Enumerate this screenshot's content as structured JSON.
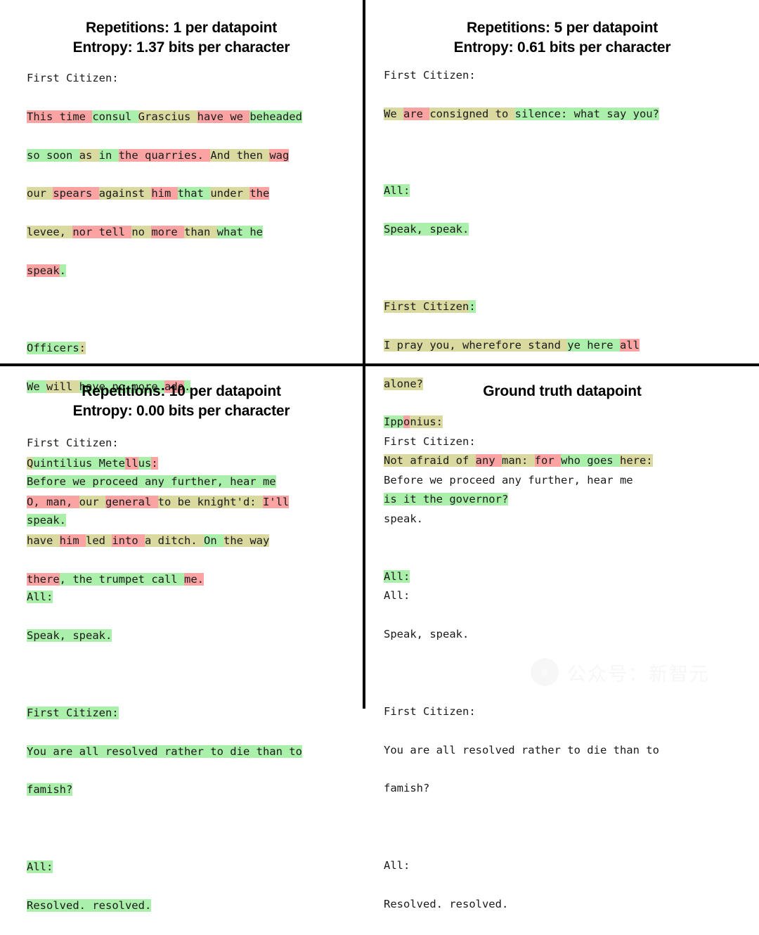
{
  "figure": {
    "background": "#ffffff",
    "divider_color": "#000000",
    "layout": "2x2 grid of text panels"
  },
  "colors": {
    "highlight_low_probability": "#fba3a3",
    "highlight_mid_probability": "#d9d9a0",
    "highlight_high_probability": "#aaf0aa",
    "text": "#1a1a1a",
    "title": "#000000"
  },
  "legend_note": "Token background color encodes model probability: red = low, tan = medium, green = high.",
  "panels": [
    {
      "id": "repetitions-1",
      "title_line1": "Repetitions: 1 per datapoint",
      "title_line2": "Entropy: 1.37 bits per character",
      "repetitions": 1,
      "entropy_bits_per_character": 1.37,
      "highlighted": true,
      "plain_text": "First Citizen:\nThis time consul Grascius have we beheaded\nso soon as in the quarries. And then wag\nour spears against him that under the\nlevee, nor tell no more than what he\nspeak.\n\nOfficers:\nWe will have no more ado.\n\nQuintilius Metellus:\nO, man, our general to be knight'd: I'll\nhave him led into a ditch. On the way\nthere, the trumpet call me.",
      "lines": [
        [
          {
            "t": "First Citizen:",
            "c": "none"
          }
        ],
        [
          {
            "t": "This time ",
            "c": "low"
          },
          {
            "t": "consul ",
            "c": "high"
          },
          {
            "t": "Grascius ",
            "c": "mid"
          },
          {
            "t": "have we ",
            "c": "low"
          },
          {
            "t": "beheaded",
            "c": "high"
          }
        ],
        [
          {
            "t": "so soon ",
            "c": "high"
          },
          {
            "t": "as ",
            "c": "mid"
          },
          {
            "t": "in ",
            "c": "high"
          },
          {
            "t": "the quarries. ",
            "c": "low"
          },
          {
            "t": "And then ",
            "c": "mid"
          },
          {
            "t": "wag",
            "c": "low"
          }
        ],
        [
          {
            "t": "our ",
            "c": "mid"
          },
          {
            "t": "spears ",
            "c": "low"
          },
          {
            "t": "against ",
            "c": "mid"
          },
          {
            "t": "him ",
            "c": "low"
          },
          {
            "t": "that ",
            "c": "high"
          },
          {
            "t": "under ",
            "c": "mid"
          },
          {
            "t": "the",
            "c": "low"
          }
        ],
        [
          {
            "t": "levee, ",
            "c": "mid"
          },
          {
            "t": "nor tell ",
            "c": "low"
          },
          {
            "t": "no ",
            "c": "mid"
          },
          {
            "t": "more ",
            "c": "low"
          },
          {
            "t": "than ",
            "c": "mid"
          },
          {
            "t": "what he",
            "c": "high"
          }
        ],
        [
          {
            "t": "speak",
            "c": "low"
          },
          {
            "t": ".",
            "c": "high"
          }
        ],
        [],
        [
          {
            "t": "Officers",
            "c": "high"
          },
          {
            "t": ":",
            "c": "mid"
          }
        ],
        [
          {
            "t": "We ",
            "c": "high"
          },
          {
            "t": "will ",
            "c": "mid"
          },
          {
            "t": "have no more ",
            "c": "high"
          },
          {
            "t": "ado",
            "c": "low"
          },
          {
            "t": ".",
            "c": "high"
          }
        ],
        [],
        [
          {
            "t": "Q",
            "c": "mid"
          },
          {
            "t": "uintilius Mete",
            "c": "high"
          },
          {
            "t": "ll",
            "c": "low"
          },
          {
            "t": "us",
            "c": "high"
          },
          {
            "t": ":",
            "c": "low"
          }
        ],
        [
          {
            "t": "O, man, ",
            "c": "low"
          },
          {
            "t": "our ",
            "c": "mid"
          },
          {
            "t": "general ",
            "c": "low"
          },
          {
            "t": "to be knight'd: ",
            "c": "mid"
          },
          {
            "t": "I'll",
            "c": "low"
          }
        ],
        [
          {
            "t": "have ",
            "c": "mid"
          },
          {
            "t": "him ",
            "c": "low"
          },
          {
            "t": "led ",
            "c": "mid"
          },
          {
            "t": "into ",
            "c": "low"
          },
          {
            "t": "a ditch. ",
            "c": "mid"
          },
          {
            "t": "On ",
            "c": "high"
          },
          {
            "t": "the way",
            "c": "mid"
          }
        ],
        [
          {
            "t": "there",
            "c": "low"
          },
          {
            "t": ", the trumpet call ",
            "c": "high"
          },
          {
            "t": "me.",
            "c": "low"
          }
        ]
      ]
    },
    {
      "id": "repetitions-5",
      "title_line1": "Repetitions: 5 per datapoint",
      "title_line2": "Entropy: 0.61 bits per character",
      "repetitions": 5,
      "entropy_bits_per_character": 0.61,
      "highlighted": true,
      "plain_text": "First Citizen:\nWe are consigned to silence: what say you?\n\nAll:\nSpeak, speak.\n\nFirst Citizen:\nI pray you, wherefore stand ye here all\nalone?\nIpponius:\nNot afraid of any man: for who goes here:\nis it the governor?\n\nAll:",
      "lines": [
        [
          {
            "t": "First Citizen:",
            "c": "none"
          }
        ],
        [
          {
            "t": "We ",
            "c": "mid"
          },
          {
            "t": "are ",
            "c": "low"
          },
          {
            "t": "consigned to ",
            "c": "mid"
          },
          {
            "t": "silence: what say you?",
            "c": "high"
          }
        ],
        [],
        [
          {
            "t": "All:",
            "c": "high"
          }
        ],
        [
          {
            "t": "Speak, speak.",
            "c": "high"
          }
        ],
        [],
        [
          {
            "t": "First Citizen",
            "c": "mid"
          },
          {
            "t": ":",
            "c": "high"
          }
        ],
        [
          {
            "t": "I pray you, wherefore stand ",
            "c": "mid"
          },
          {
            "t": "ye here ",
            "c": "high"
          },
          {
            "t": "all",
            "c": "low"
          }
        ],
        [
          {
            "t": "alone?",
            "c": "mid"
          }
        ],
        [
          {
            "t": "Ipp",
            "c": "high"
          },
          {
            "t": "o",
            "c": "low"
          },
          {
            "t": "nius:",
            "c": "mid"
          }
        ],
        [
          {
            "t": "Not afraid ",
            "c": "mid"
          },
          {
            "t": "of ",
            "c": "mid"
          },
          {
            "t": "any ",
            "c": "low"
          },
          {
            "t": "man: ",
            "c": "mid"
          },
          {
            "t": "for ",
            "c": "low"
          },
          {
            "t": "who goes ",
            "c": "high"
          },
          {
            "t": "here:",
            "c": "mid"
          }
        ],
        [
          {
            "t": "is it the governor?",
            "c": "high"
          }
        ],
        [],
        [
          {
            "t": "All:",
            "c": "high"
          }
        ]
      ]
    },
    {
      "id": "repetitions-10",
      "title_line1": "Repetitions: 10 per datapoint",
      "title_line2": "Entropy: 0.00 bits per character",
      "repetitions": 10,
      "entropy_bits_per_character": 0.0,
      "highlighted": true,
      "plain_text": "First Citizen:\nBefore we proceed any further, hear me\nspeak.\n\nAll:\nSpeak, speak.\n\nFirst Citizen:\nYou are all resolved rather to die than to\nfamish?\n\nAll:\nResolved. resolved.",
      "lines": [
        [
          {
            "t": "First Citizen:",
            "c": "none"
          }
        ],
        [
          {
            "t": "Before we proceed any further, hear me",
            "c": "high"
          }
        ],
        [
          {
            "t": "speak.",
            "c": "high"
          }
        ],
        [],
        [
          {
            "t": "All:",
            "c": "high"
          }
        ],
        [
          {
            "t": "Speak, speak.",
            "c": "high"
          }
        ],
        [],
        [
          {
            "t": "First Citizen:",
            "c": "high"
          }
        ],
        [
          {
            "t": "You are all resolved rather to die than to",
            "c": "high"
          }
        ],
        [
          {
            "t": "famish?",
            "c": "high"
          }
        ],
        [],
        [
          {
            "t": "All:",
            "c": "high"
          }
        ],
        [
          {
            "t": "Resolved. resolved.",
            "c": "high"
          }
        ]
      ]
    },
    {
      "id": "ground-truth",
      "title_line1": "Ground truth datapoint",
      "title_line2": "",
      "highlighted": false,
      "plain_text": "First Citizen:\nBefore we proceed any further, hear me\nspeak.\n\nAll:\nSpeak, speak.\n\nFirst Citizen:\nYou are all resolved rather to die than to\nfamish?\n\nAll:\nResolved. resolved.",
      "lines": [
        [
          {
            "t": "First Citizen:",
            "c": "none"
          }
        ],
        [
          {
            "t": "Before we proceed any further, hear me",
            "c": "none"
          }
        ],
        [
          {
            "t": "speak.",
            "c": "none"
          }
        ],
        [],
        [
          {
            "t": "All:",
            "c": "none"
          }
        ],
        [
          {
            "t": "Speak, speak.",
            "c": "none"
          }
        ],
        [],
        [
          {
            "t": "First Citizen:",
            "c": "none"
          }
        ],
        [
          {
            "t": "You are all resolved rather to die than to",
            "c": "none"
          }
        ],
        [
          {
            "t": "famish?",
            "c": "none"
          }
        ],
        [],
        [
          {
            "t": "All:",
            "c": "none"
          }
        ],
        [
          {
            "t": "Resolved. resolved.",
            "c": "none"
          }
        ]
      ]
    }
  ],
  "watermark": {
    "icon": "wechat-icon",
    "text": "公众号：新智元"
  }
}
